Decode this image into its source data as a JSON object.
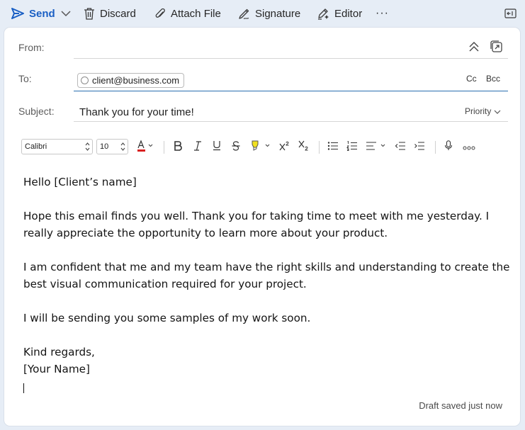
{
  "toolbar": {
    "send_label": "Send",
    "discard_label": "Discard",
    "attach_label": "Attach File",
    "signature_label": "Signature",
    "editor_label": "Editor",
    "more_label": "···"
  },
  "header": {
    "from_label": "From:",
    "to_label": "To:",
    "subject_label": "Subject:",
    "recipient": "client@business.com",
    "cc_label": "Cc",
    "bcc_label": "Bcc",
    "subject_value": "Thank you for your time!",
    "priority_label": "Priority"
  },
  "format": {
    "font_family": "Calibri",
    "font_size": "10",
    "font_color": "#d92020",
    "highlight_color": "#f0e020",
    "icons": [
      "bold-icon",
      "italic-icon",
      "underline-icon",
      "strikethrough-icon",
      "highlight-icon",
      "superscript-icon",
      "subscript-icon",
      "bullet-list-icon",
      "numbered-list-icon",
      "align-icon",
      "decrease-indent-icon",
      "increase-indent-icon",
      "dictate-icon",
      "more-options-icon"
    ]
  },
  "body": {
    "greeting": "Hello [Client’s name]",
    "paragraph1": "Hope this email finds you well. Thank you for taking time to meet with me yesterday. I really appreciate the opportunity to learn more about your product.",
    "paragraph2": "I am confident that me and my team have the right skills and understanding to create the best visual communication required for your project.",
    "paragraph3": "I will be sending you some samples of my work soon.",
    "closing": "Kind regards,",
    "signature": "[Your Name]"
  },
  "status": {
    "draft": "Draft saved just now"
  },
  "colors": {
    "accent": "#1a5fc4",
    "background": "#e6edf6",
    "active_field_line": "#2a6fb0"
  }
}
